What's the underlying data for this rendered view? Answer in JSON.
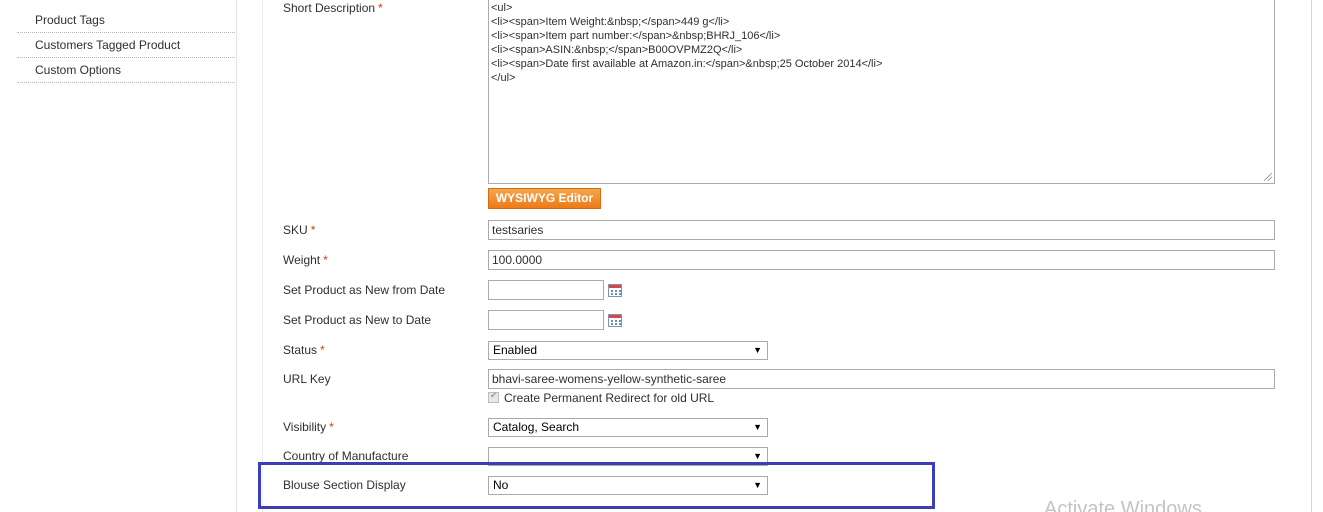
{
  "sidebar": {
    "items": [
      {
        "label": "Product Tags"
      },
      {
        "label": "Customers Tagged Product"
      },
      {
        "label": "Custom Options"
      }
    ]
  },
  "form": {
    "short_description": {
      "label": "Short Description",
      "value": "<ul>\n<li><span>Item Weight:&nbsp;</span>449 g</li>\n<li><span>Item part number:</span>&nbsp;BHRJ_106</li>\n<li><span>ASIN:&nbsp;</span>B00OVPMZ2Q</li>\n<li><span>Date first available at Amazon.in:</span>&nbsp;25 October 2014</li>\n</ul>",
      "editor_button": "WYSIWYG Editor"
    },
    "sku": {
      "label": "SKU",
      "value": "testsaries"
    },
    "weight": {
      "label": "Weight",
      "value": "100.0000"
    },
    "new_from": {
      "label": "Set Product as New from Date",
      "value": ""
    },
    "new_to": {
      "label": "Set Product as New to Date",
      "value": ""
    },
    "status": {
      "label": "Status",
      "value": "Enabled"
    },
    "url_key": {
      "label": "URL Key",
      "value": "bhavi-saree-womens-yellow-synthetic-saree",
      "redirect_label": "Create Permanent Redirect for old URL"
    },
    "visibility": {
      "label": "Visibility",
      "value": "Catalog, Search"
    },
    "country": {
      "label": "Country of Manufacture",
      "value": ""
    },
    "blouse": {
      "label": "Blouse Section Display",
      "value": "No"
    }
  },
  "required_mark": "*",
  "select_arrow": "▼",
  "watermark": "Activate Windows",
  "colors": {
    "required": "#eb340a",
    "button": "#ed7b14",
    "highlight": "#3b3fb7"
  },
  "icons": {
    "calendar": "calendar-icon",
    "dropdown": "chevron-down-icon"
  }
}
